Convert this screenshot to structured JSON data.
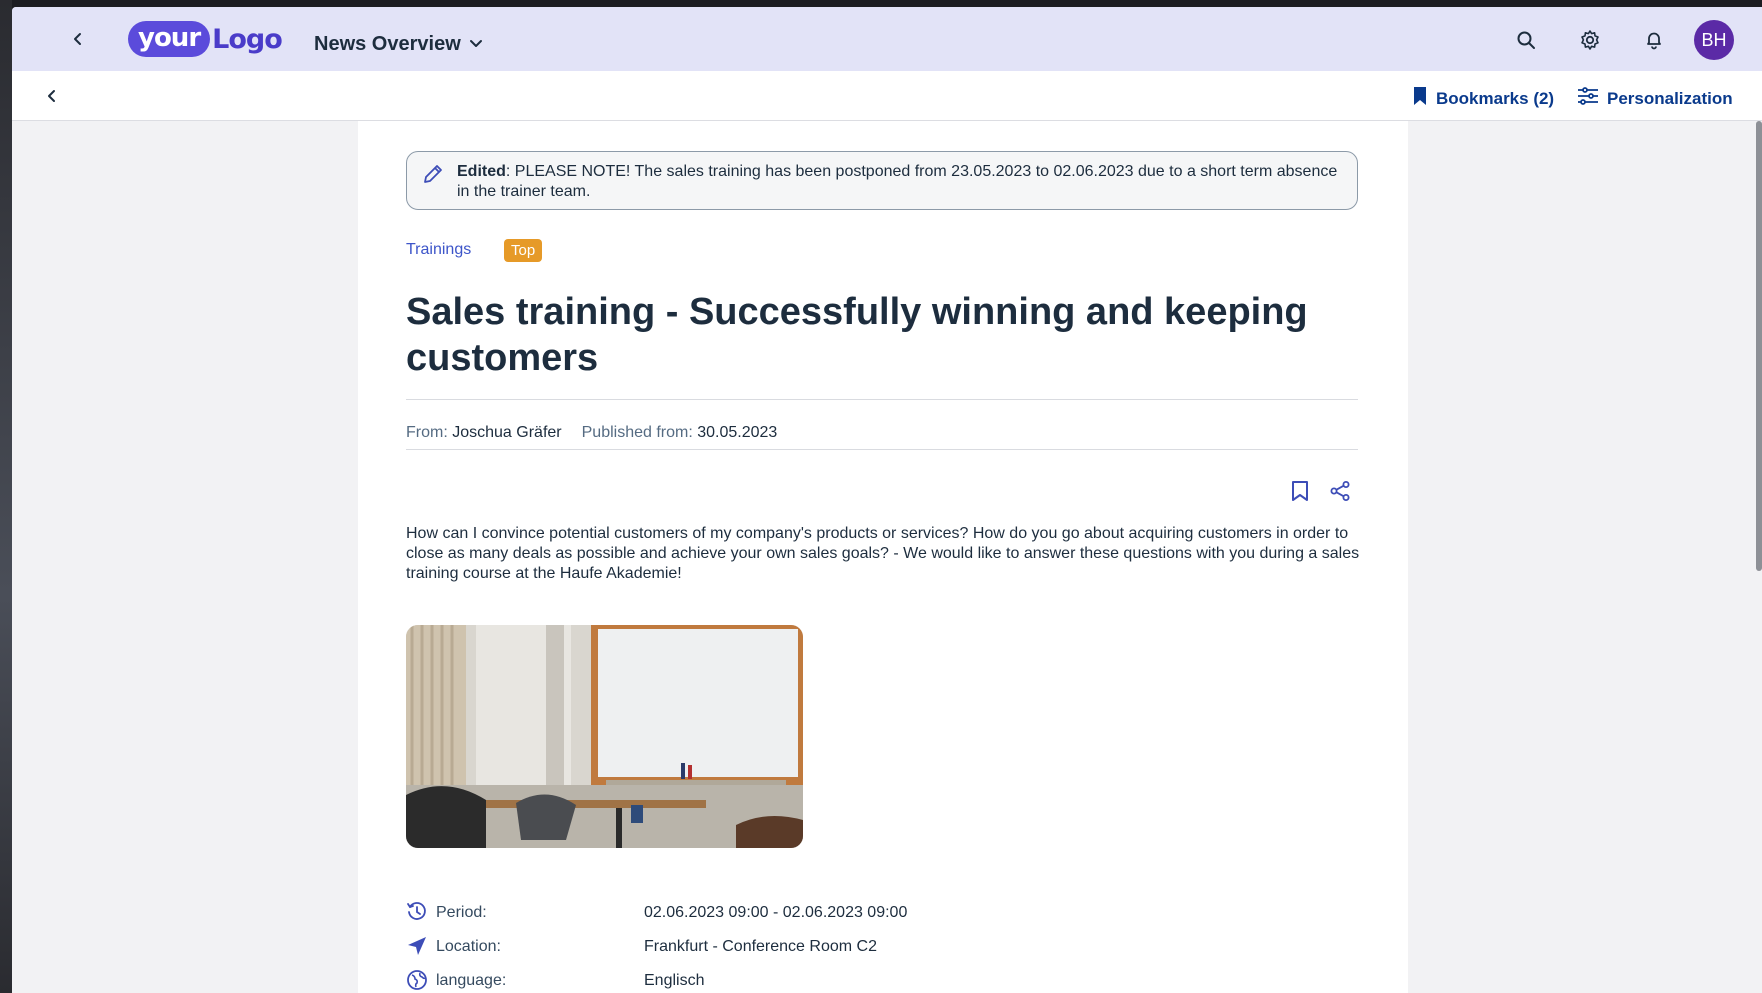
{
  "shellbar": {
    "logo_your": "your",
    "logo_word": "Logo",
    "app_title": "News Overview",
    "avatar_initials": "BH",
    "icons": [
      "back-icon",
      "search-icon",
      "gear-icon",
      "bell-icon"
    ]
  },
  "subbar": {
    "bookmarks_label": "Bookmarks (2)",
    "personalization_label": "Personalization"
  },
  "notice": {
    "prefix": "Edited",
    "text": ": PLEASE NOTE! The sales training has been postponed from 23.05.2023 to 02.06.2023 due to a short term absence in the trainer team."
  },
  "article": {
    "category": "Trainings",
    "badge": "Top",
    "title": "Sales training - Successfully winning and keeping customers",
    "from_label": "From:",
    "author": "Joschua Gräfer",
    "published_label": "Published from:",
    "published_date": "30.05.2023",
    "body": "How can I convince potential customers of my company's products or services? How do you go about acquiring customers in order to close as many deals as possible and achieve your own sales goals? - We would like to answer these questions with you during a sales training course at the Haufe Akademie!",
    "details": [
      {
        "label": "Period:",
        "value": "02.06.2023 09:00 - 02.06.2023 09:00",
        "icon": "history-icon"
      },
      {
        "label": "Location:",
        "value": "Frankfurt - Conference Room C2",
        "icon": "location-arrow-icon"
      },
      {
        "label": "language:",
        "value": "Englisch",
        "icon": "globe-icon"
      }
    ]
  },
  "colors": {
    "shellbar_bg": "#e2e3f7",
    "accent": "#3d4db7",
    "badge": "#e69a28",
    "avatar": "#5b2aa6"
  }
}
